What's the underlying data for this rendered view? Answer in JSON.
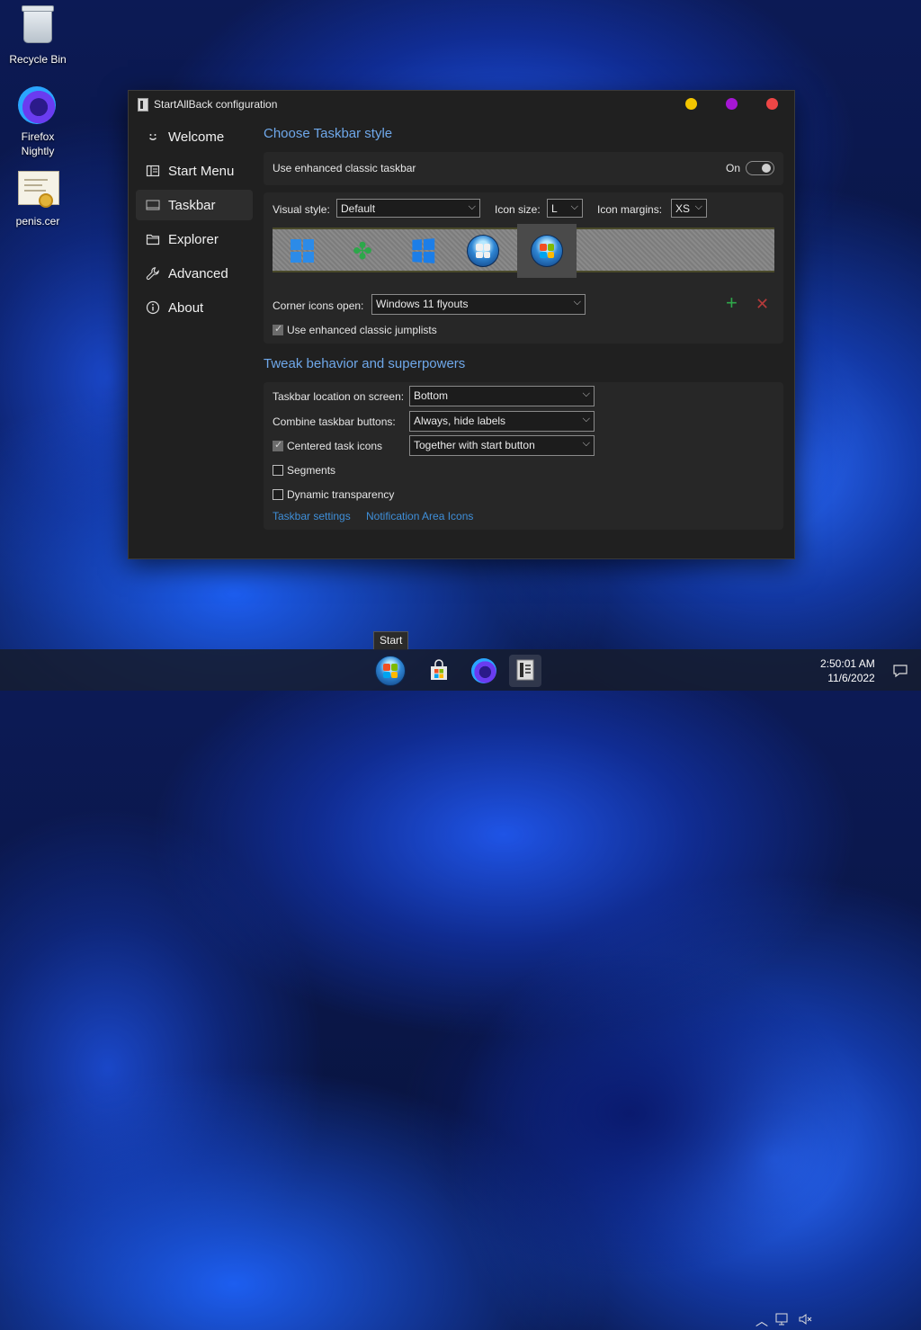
{
  "desktop": {
    "icons": [
      {
        "label": "Recycle Bin",
        "icon": "recycle-bin-icon"
      },
      {
        "label": "Firefox\nNightly",
        "line1": "Firefox",
        "line2": "Nightly",
        "icon": "firefox-nightly-icon"
      },
      {
        "label": "penis.cer",
        "icon": "certificate-icon"
      }
    ]
  },
  "window": {
    "title": "StartAllBack configuration",
    "controls": {
      "minimize": "#f3c500",
      "maximize": "#a516d4",
      "close": "#ee4646"
    }
  },
  "nav": {
    "items": [
      {
        "label": "Welcome",
        "icon": "smiley-icon"
      },
      {
        "label": "Start Menu",
        "icon": "start-menu-icon"
      },
      {
        "label": "Taskbar",
        "icon": "taskbar-icon",
        "active": true
      },
      {
        "label": "Explorer",
        "icon": "folder-icon"
      },
      {
        "label": "Advanced",
        "icon": "wrench-icon"
      },
      {
        "label": "About",
        "icon": "info-icon"
      }
    ]
  },
  "taskbar_style": {
    "title": "Choose Taskbar style",
    "enhanced_label": "Use enhanced classic taskbar",
    "enhanced_state": "On",
    "visual_style_label": "Visual style:",
    "visual_style_value": "Default",
    "icon_size_label": "Icon size:",
    "icon_size_value": "L",
    "icon_margins_label": "Icon margins:",
    "icon_margins_value": "XS",
    "start_button_styles": [
      "windows-11-logo",
      "clover-logo",
      "windows-10-logo",
      "windows-7-orb",
      "windows-7-orb-colored"
    ],
    "selected_style_index": 4,
    "corner_icons_label": "Corner icons open:",
    "corner_icons_value": "Windows 11 flyouts",
    "jumplists_label": "Use enhanced classic jumplists",
    "jumplists_checked": true
  },
  "tweaks": {
    "title": "Tweak behavior and superpowers",
    "location_label": "Taskbar location on screen:",
    "location_value": "Bottom",
    "combine_label": "Combine taskbar buttons:",
    "combine_value": "Always, hide labels",
    "centered_label": "Centered task icons",
    "centered_checked": true,
    "centered_value": "Together with start button",
    "segments_label": "Segments",
    "segments_checked": false,
    "transparency_label": "Dynamic transparency",
    "transparency_checked": false,
    "link_taskbar_settings": "Taskbar settings",
    "link_notification_icons": "Notification Area Icons"
  },
  "taskbar": {
    "tooltip": "Start",
    "apps": [
      "start-orb-icon",
      "microsoft-store-icon",
      "firefox-nightly-icon",
      "startallback-icon"
    ],
    "time": "2:50:01 AM",
    "date": "11/6/2022"
  }
}
